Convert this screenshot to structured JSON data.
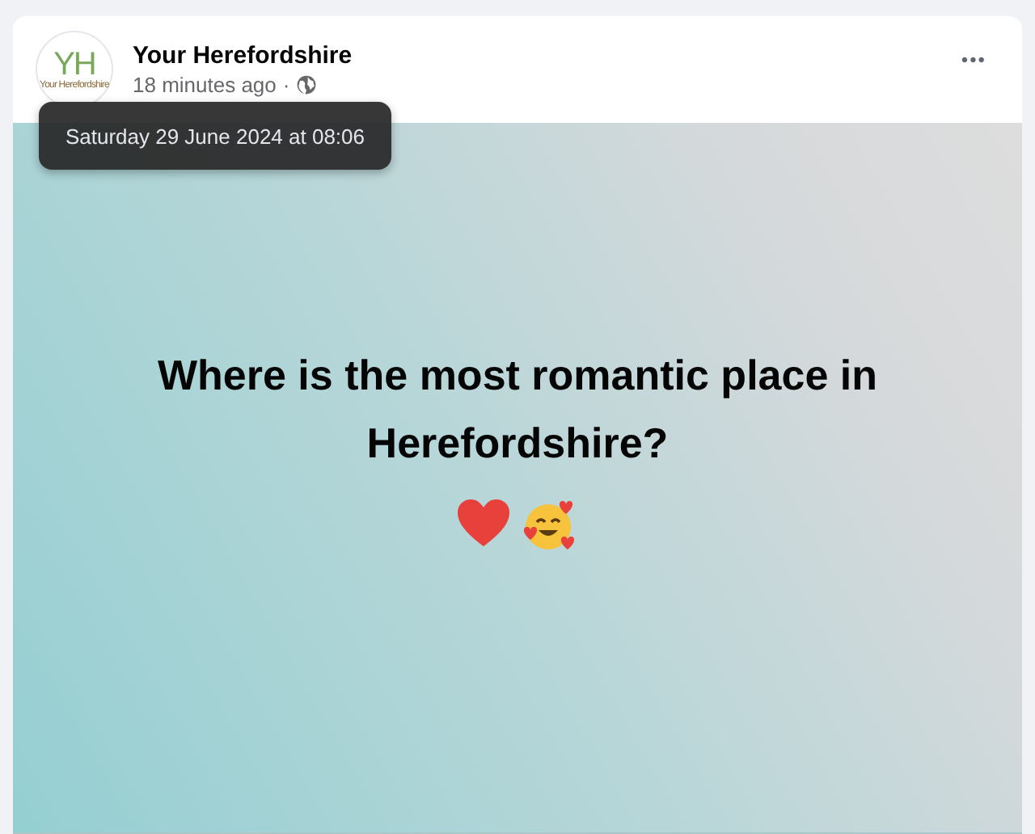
{
  "post": {
    "avatar": {
      "monogram": "YH",
      "caption": "Your Herefordshire"
    },
    "author": "Your Herefordshire",
    "time": "18 minutes ago",
    "separator": "·",
    "tooltip": "Saturday 29 June 2024 at 08:06",
    "more": "•••"
  },
  "content": {
    "text": "Where is the most romantic place in Herefordshire?"
  }
}
